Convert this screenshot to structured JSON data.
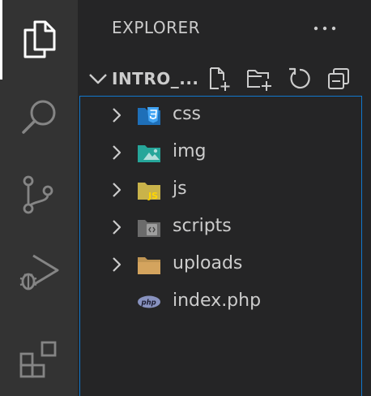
{
  "explorer": {
    "title": "EXPLORER",
    "folder_name": "INTRO_..."
  },
  "tree": {
    "items": [
      {
        "label": "css",
        "type": "folder",
        "icon": "css-folder-icon"
      },
      {
        "label": "img",
        "type": "folder",
        "icon": "image-folder-icon"
      },
      {
        "label": "js",
        "type": "folder",
        "icon": "js-folder-icon"
      },
      {
        "label": "scripts",
        "type": "folder",
        "icon": "scripts-folder-icon"
      },
      {
        "label": "uploads",
        "type": "folder",
        "icon": "folder-icon"
      },
      {
        "label": "index.php",
        "type": "file",
        "icon": "php-file-icon"
      }
    ]
  },
  "colors": {
    "activity_bar": "#333333",
    "sidebar": "#252526",
    "text": "#cccccc",
    "focus_border": "#1177cc",
    "css_blue": "#42a5f5",
    "img_teal": "#26a69a",
    "js_yellow": "#ffca28",
    "folder_brown": "#c09553",
    "scripts_gray": "#7b7b7b",
    "php_purple": "#8892bf"
  }
}
